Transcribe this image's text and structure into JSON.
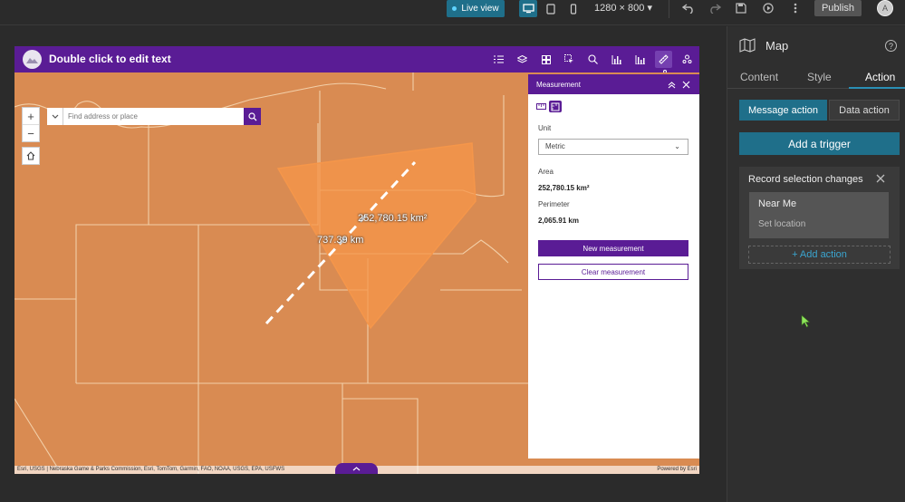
{
  "topbar": {
    "live_view_label": "Live view",
    "screen_size": "1280 × 800",
    "publish_label": "Publish",
    "avatar_initial": "A"
  },
  "app": {
    "title": "Double click to edit text",
    "search": {
      "placeholder": "Find address or place"
    },
    "zoom_in": "+",
    "zoom_out": "−",
    "attribution": "Esri, USGS | Nebraska Game & Parks Commission, Esri, TomTom, Garmin, FAO, NOAA, USGS, EPA, USFWS",
    "powered_by": "Powered by Esri"
  },
  "map": {
    "area_label": "252,780.15 km²",
    "distance_label": "737.39 km",
    "fill_color": "#d98b52",
    "polygon_color": "#f5964a"
  },
  "measurement": {
    "title": "Measurement",
    "unit_label": "Unit",
    "unit_value": "Metric",
    "area_label": "Area",
    "area_value": "252,780.15 km²",
    "perimeter_label": "Perimeter",
    "perimeter_value": "2,065.91 km",
    "new_button": "New measurement",
    "clear_button": "Clear measurement"
  },
  "settings": {
    "title": "Map",
    "tabs": [
      "Content",
      "Style",
      "Action"
    ],
    "active_tab": "Action",
    "message_action": "Message action",
    "data_action": "Data action",
    "add_trigger": "Add a trigger",
    "card": {
      "title": "Record selection changes",
      "action_name": "Near Me",
      "action_sub": "Set location",
      "add_action": "+ Add action"
    }
  },
  "colors": {
    "brand_purple": "#5a1c95",
    "accent_teal": "#1f6f8a"
  }
}
